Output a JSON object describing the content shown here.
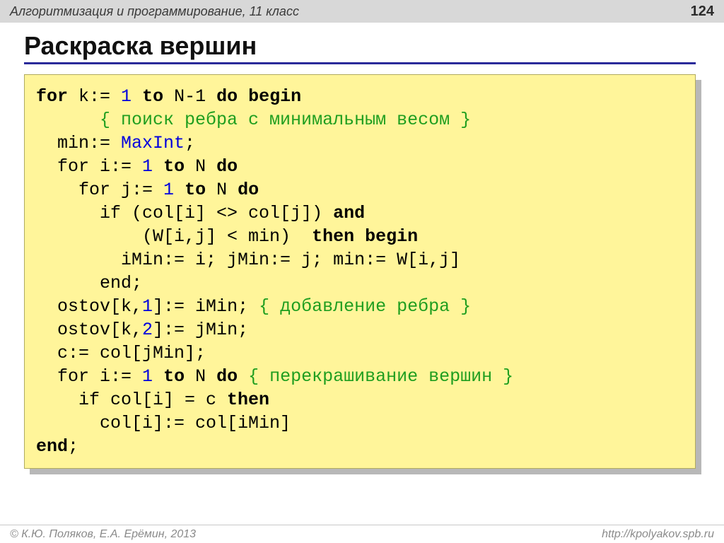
{
  "header": {
    "course": "Алгоритмизация и программирование, 11 класс",
    "page": "124"
  },
  "title": "Раскраска вершин",
  "kw": {
    "for": "for",
    "to": "to",
    "do": "do",
    "begin": "begin",
    "end": "end",
    "if": "if",
    "then": "then",
    "and": "and"
  },
  "ident": {
    "MaxInt": "MaxInt"
  },
  "num": {
    "one": "1",
    "two": "2"
  },
  "cmt": {
    "search": "{ поиск ребра с минимальным весом }",
    "add": "{ добавление ребра }",
    "recolor": "{ перекрашивание вершин }"
  },
  "txt": {
    "k_assign": " k:= ",
    "to_Nm1": " N-1 ",
    "min_assign": "  min:= ",
    "semi": ";",
    "for_i": "  for i:= ",
    "to_N": " N ",
    "for_j": "    for j:= ",
    "if_cond1": "      if (col[i] <> col[j]) ",
    "if_cond2": "          (W[i,j] < min)  ",
    "imin_line": "        iMin:= i; jMin:= j; min:= W[i,j]",
    "end1": "      end",
    "ostov1_a": "  ostov[k,",
    "ostov1_b": "]:= iMin; ",
    "ostov2_a": "  ostov[k,",
    "ostov2_b": "]:= jMin;",
    "c_assign": "  c:= col[jMin];",
    "for_i2": "  for i:= ",
    "if_col": "    if col[i] = c ",
    "col_assign": "      col[i]:= col[iMin]",
    "space": " "
  },
  "footer": {
    "left": "© К.Ю. Поляков, Е.А. Ерёмин, 2013",
    "right": "http://kpolyakov.spb.ru"
  }
}
